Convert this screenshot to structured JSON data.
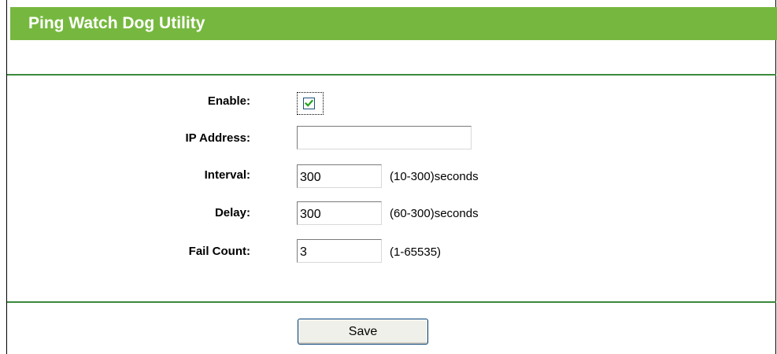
{
  "header": {
    "title": "Ping Watch Dog Utility"
  },
  "form": {
    "enable": {
      "label": "Enable:",
      "checked": true
    },
    "ip_address": {
      "label": "IP Address:",
      "value": ""
    },
    "interval": {
      "label": "Interval:",
      "value": "300",
      "hint": "(10-300)seconds"
    },
    "delay": {
      "label": "Delay:",
      "value": "300",
      "hint": "(60-300)seconds"
    },
    "fail_count": {
      "label": "Fail Count:",
      "value": "3",
      "hint": "(1-65535)"
    }
  },
  "actions": {
    "save_label": "Save"
  },
  "colors": {
    "header_bg": "#76b83f",
    "divider": "#3b8a3b",
    "checkmark": "#21a121"
  },
  "icons": {
    "checkbox_mark": "checkmark-icon"
  }
}
